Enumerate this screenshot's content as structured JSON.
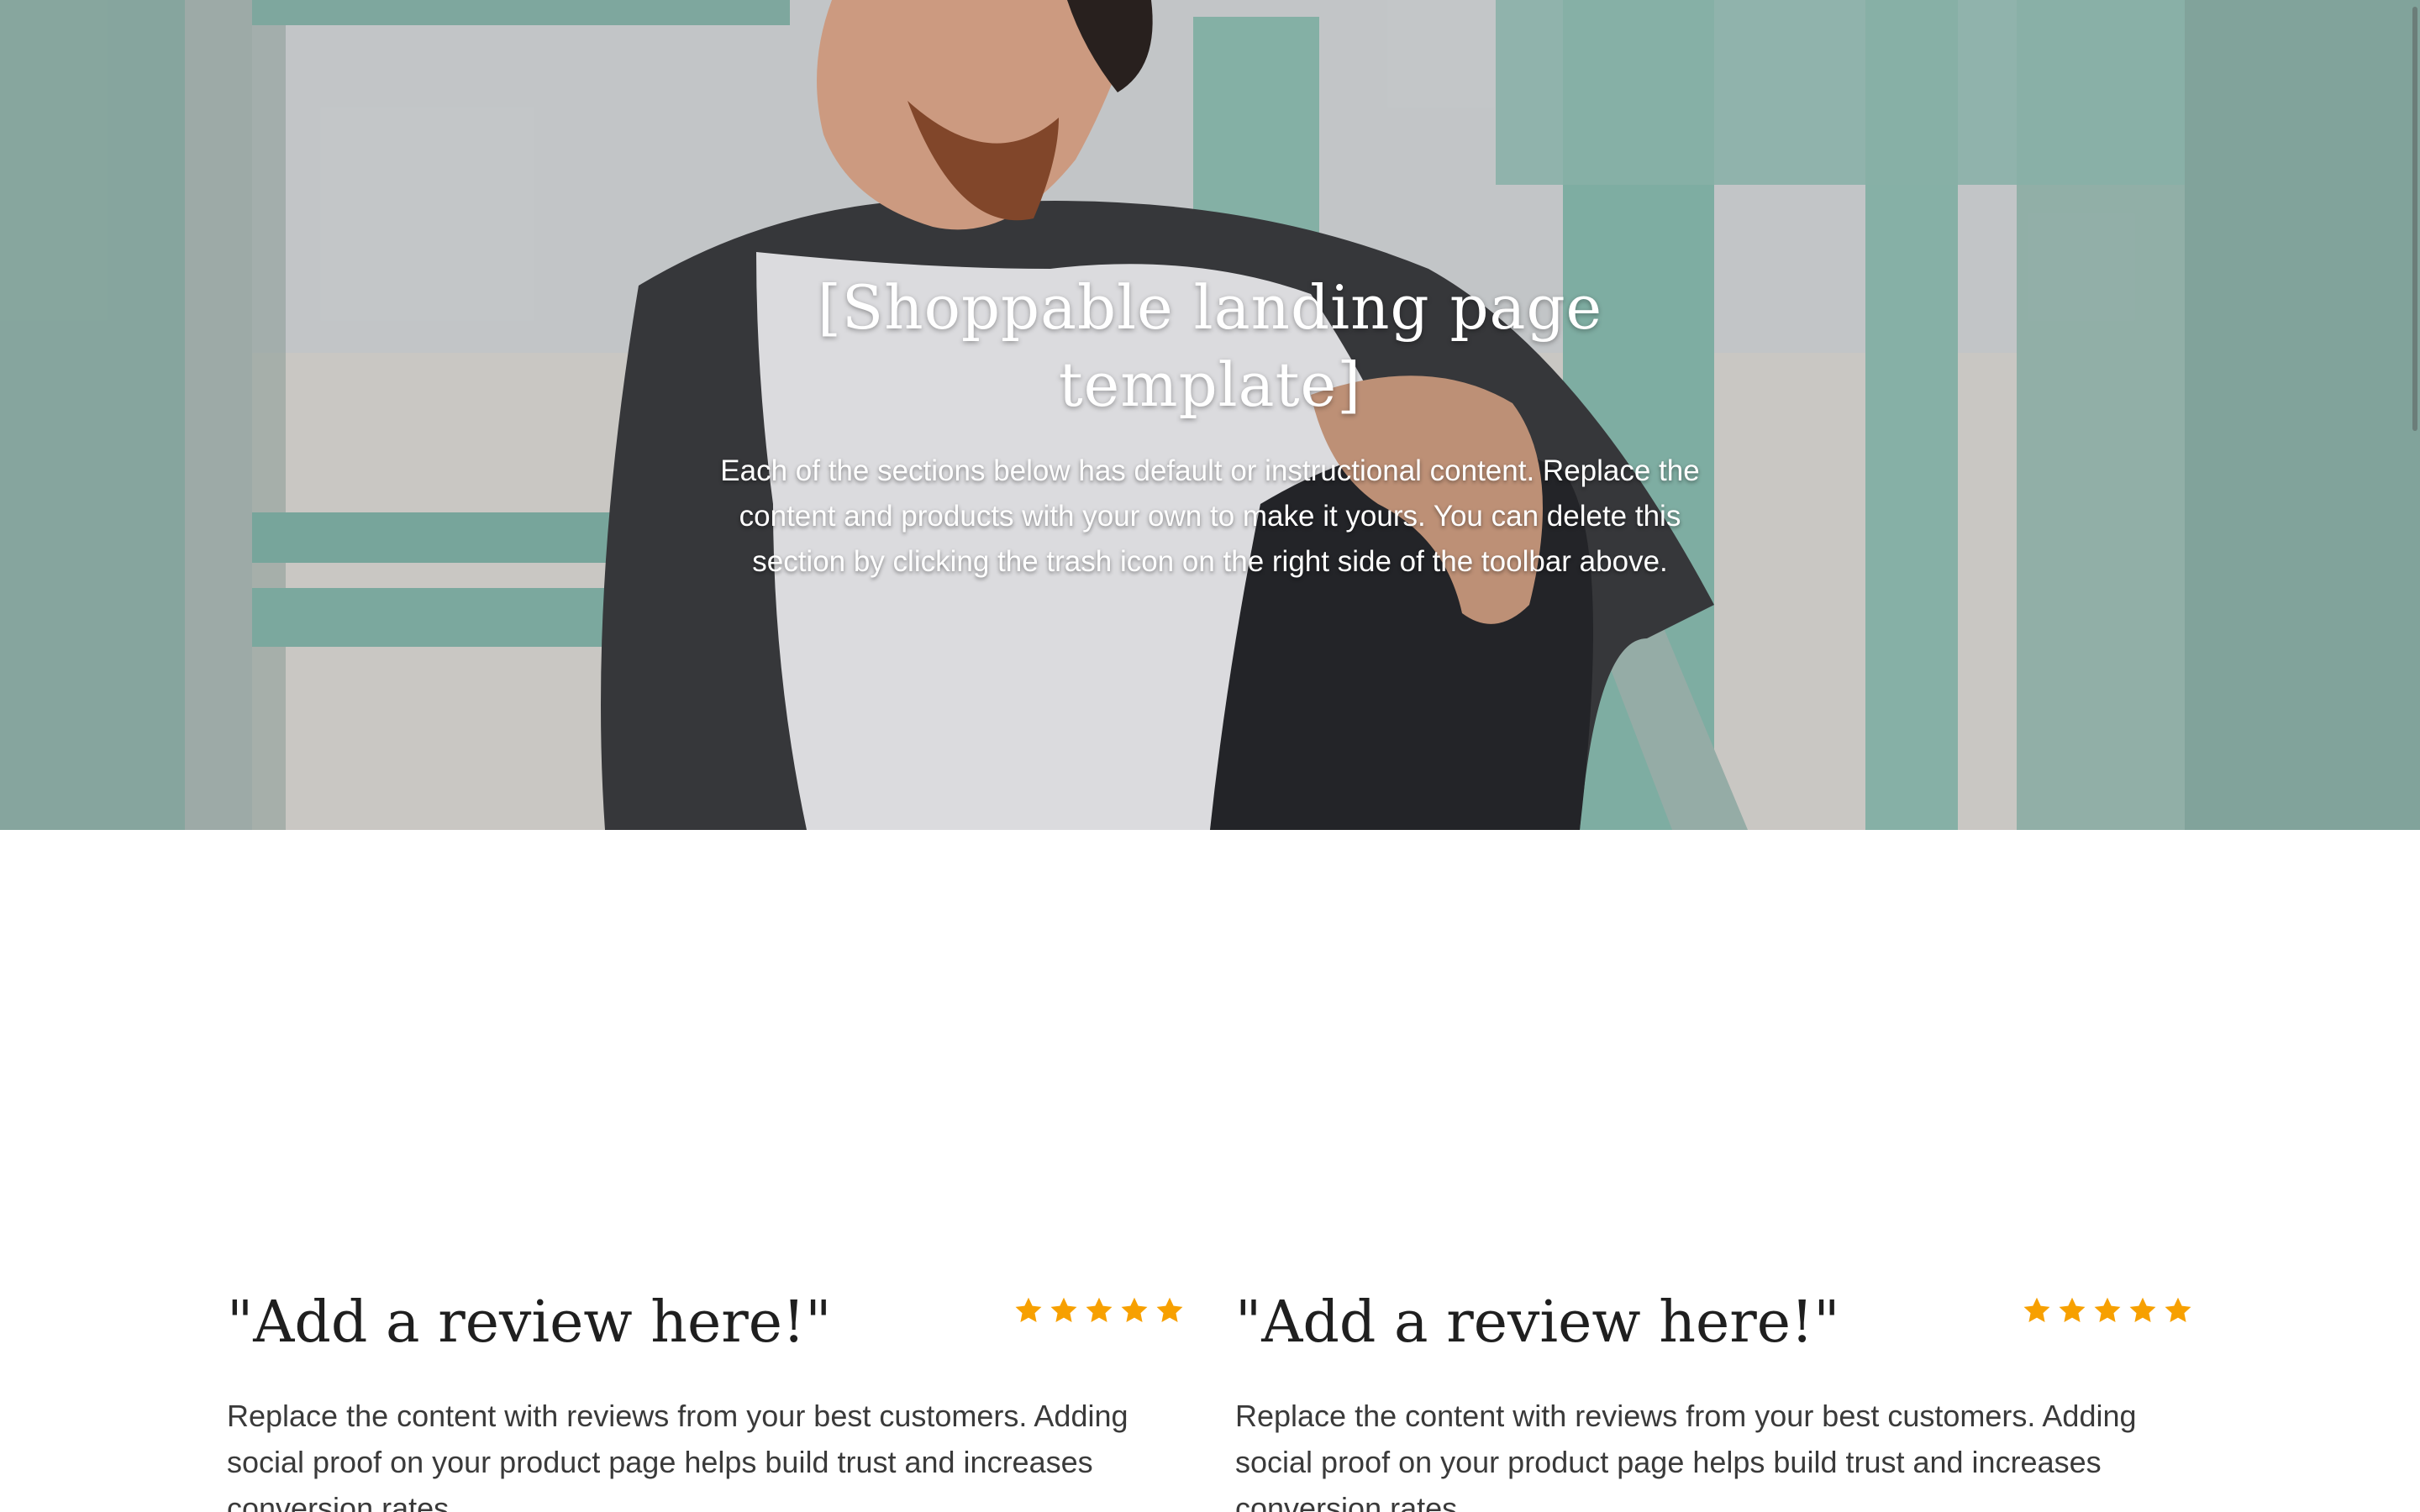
{
  "hero": {
    "title": "[Shoppable landing page template]",
    "subtitle": "Each of the sections below has default or instructional content. Replace the content and products with your own to make it yours. You can delete this section by clicking the trash icon on the right side of the toolbar above."
  },
  "reviews": [
    {
      "title": "\"Add a review here!\"",
      "rating": 5,
      "body": "Replace the content with reviews from your best customers. Adding social proof on your product page helps build trust and increases conversion rates."
    },
    {
      "title": "\"Add a review here!\"",
      "rating": 5,
      "body": "Replace the content with reviews from your best customers. Adding social proof on your product page helps build trust and increases conversion rates."
    }
  ],
  "colors": {
    "star": "#f7a000",
    "text_dark": "#1f1f1f",
    "text_body": "#3a3a3a",
    "hero_text": "#ffffff"
  },
  "icons": {
    "star": "star-icon"
  }
}
